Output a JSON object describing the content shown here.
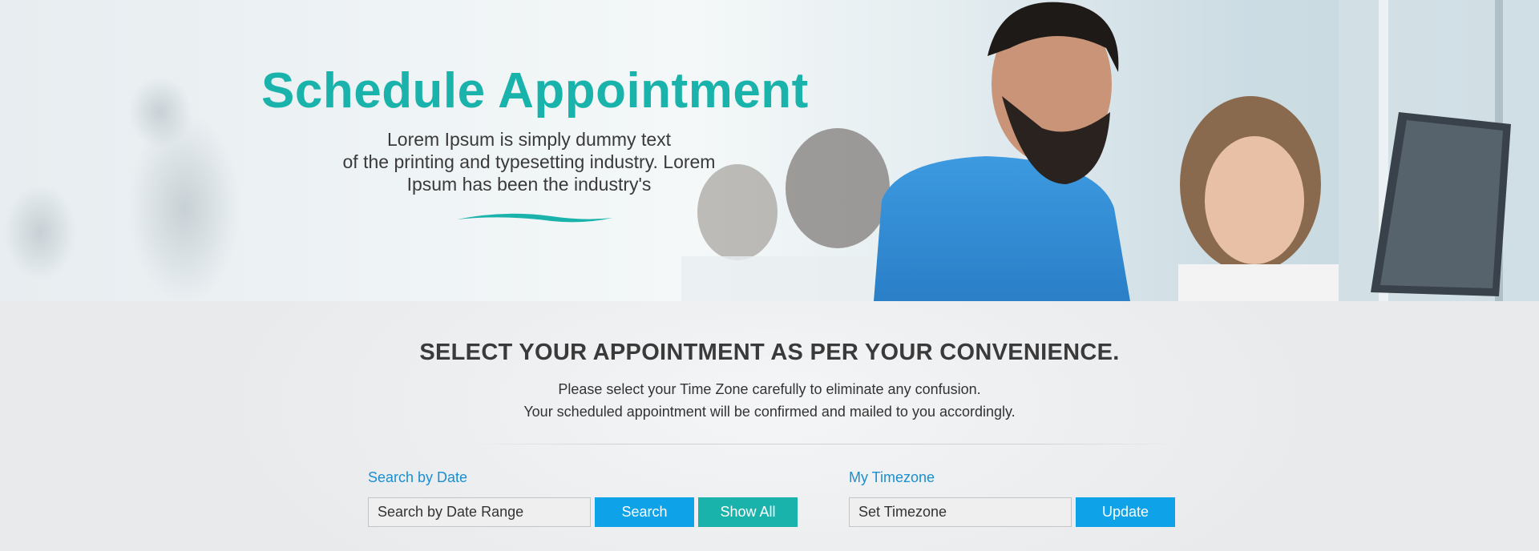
{
  "hero": {
    "title": "Schedule Appointment",
    "subtitle_lines": [
      "Lorem Ipsum is simply dummy text",
      "of the printing and typesetting industry. Lorem",
      "Ipsum has been the industry's"
    ]
  },
  "section": {
    "heading": "SELECT YOUR APPOINTMENT AS PER YOUR CONVENIENCE.",
    "description_lines": [
      "Please select your Time Zone carefully to eliminate any confusion.",
      "Your scheduled appointment will be confirmed and mailed to you accordingly."
    ]
  },
  "search": {
    "label": "Search by Date",
    "placeholder": "Search by Date Range",
    "search_button": "Search",
    "show_all_button": "Show All"
  },
  "timezone": {
    "label": "My Timezone",
    "placeholder": "Set Timezone",
    "update_button": "Update"
  },
  "colors": {
    "accent_teal": "#1ab3ab",
    "button_blue": "#0ea2e8",
    "label_blue": "#1a8fd0",
    "heading": "#3a3a3a"
  }
}
